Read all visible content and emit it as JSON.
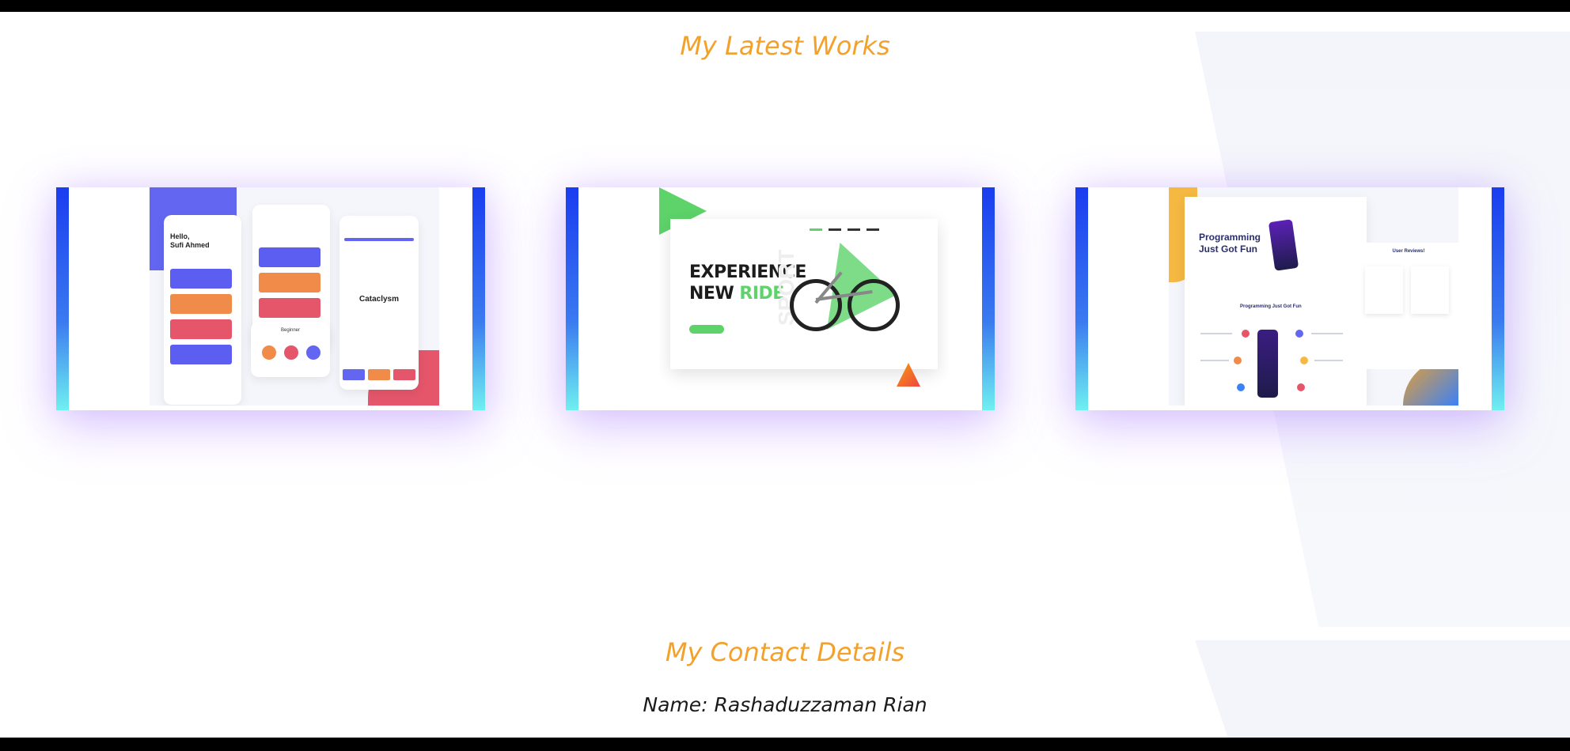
{
  "works": {
    "title": "My Latest Works",
    "cards": [
      {
        "greeting": "Hello,",
        "name": "Sufi Ahmed",
        "word": "Cataclysm",
        "level_label": "Beginner"
      },
      {
        "headline_1": "EXPERIENCE",
        "headline_2": "NEW",
        "headline_accent": "RIDE",
        "side_text": "SPORT"
      },
      {
        "headline_1": "Programming",
        "headline_2": "Just Got Fun",
        "subtitle": "Programming Just Got Fun",
        "reviews": "User Reviews!"
      }
    ]
  },
  "contact": {
    "title": "My Contact Details",
    "name_line": "Name: Rashaduzzaman Rian"
  },
  "colors": {
    "accent": "#f3a12a",
    "card_edge_top": "#1a3cf0",
    "card_edge_bottom": "#6ff0f0",
    "glow": "#a06eff"
  }
}
